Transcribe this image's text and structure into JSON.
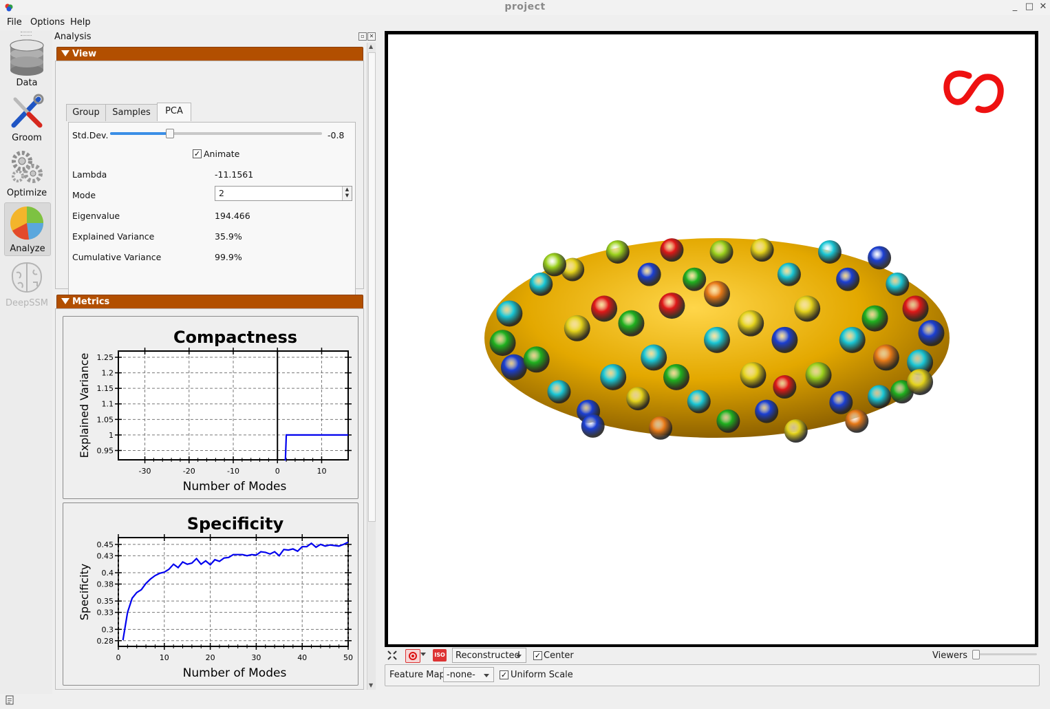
{
  "window": {
    "title": "project"
  },
  "menu": [
    "File",
    "Options",
    "Help"
  ],
  "toolbar": {
    "items": [
      {
        "label": "Data",
        "icon": "database-icon"
      },
      {
        "label": "Groom",
        "icon": "groom-tools-icon"
      },
      {
        "label": "Optimize",
        "icon": "gears-icon"
      },
      {
        "label": "Analyze",
        "icon": "pie-chart-icon"
      },
      {
        "label": "DeepSSM",
        "icon": "brain-icon"
      }
    ],
    "active": "Analyze"
  },
  "analysis": {
    "title": "Analysis",
    "view_section": "View",
    "tabs": [
      "Group",
      "Samples",
      "PCA"
    ],
    "active_tab": "PCA",
    "std_dev": {
      "label": "Std.Dev.",
      "value": "-0.8",
      "position_fraction": 0.28
    },
    "animate": {
      "label": "Animate",
      "checked": true
    },
    "rows": [
      {
        "label": "Lambda",
        "value": "-11.1561"
      },
      {
        "label": "Mode",
        "value": "2"
      },
      {
        "label": "Eigenvalue",
        "value": "194.466"
      },
      {
        "label": "Explained Variance",
        "value": "35.9%"
      },
      {
        "label": "Cumulative Variance",
        "value": "99.9%"
      }
    ],
    "metrics_section": "Metrics"
  },
  "chart_data": [
    {
      "type": "line",
      "title": "Compactness",
      "xlabel": "Number of Modes",
      "ylabel": "Explained Variance",
      "xlim": [
        -36,
        16
      ],
      "ylim": [
        0.92,
        1.27
      ],
      "xticks": [
        -30,
        -20,
        -10,
        0,
        10
      ],
      "yticks": [
        0.95,
        1,
        1.05,
        1.1,
        1.15,
        1.2,
        1.25
      ],
      "ytick_labels": [
        "0.95",
        "1",
        "1.05",
        "1.1",
        "1.15",
        "1.2",
        "1.25"
      ],
      "grid": true,
      "series": [
        {
          "color": "#0000ee",
          "x": [
            1.6,
            1.8,
            2,
            3,
            5,
            8,
            11,
            14,
            16
          ],
          "y": [
            0.92,
            0.92,
            1.0,
            1.0,
            1.0,
            1.0,
            1.0,
            1.0,
            1.0
          ]
        }
      ]
    },
    {
      "type": "line",
      "title": "Specificity",
      "xlabel": "Number of Modes",
      "ylabel": "Specificity",
      "xlim": [
        0,
        50
      ],
      "ylim": [
        0.27,
        0.462
      ],
      "xticks": [
        0,
        10,
        20,
        30,
        40,
        50
      ],
      "yticks": [
        0.28,
        0.3,
        0.33,
        0.35,
        0.38,
        0.4,
        0.43,
        0.45
      ],
      "ytick_labels": [
        "0.28",
        "0.3",
        "0.33",
        "0.35",
        "0.38",
        "0.4",
        "0.43",
        "0.45"
      ],
      "grid": true,
      "series": [
        {
          "color": "#0000ee",
          "x": [
            1,
            2,
            3,
            4,
            5,
            6,
            7,
            8,
            9,
            10,
            11,
            12,
            13,
            14,
            15,
            16,
            17,
            18,
            19,
            20,
            21,
            22,
            23,
            24,
            25,
            26,
            27,
            28,
            29,
            30,
            31,
            32,
            33,
            34,
            35,
            36,
            37,
            38,
            39,
            40,
            41,
            42,
            43,
            44,
            45,
            46,
            47,
            48,
            49,
            50
          ],
          "y": [
            0.281,
            0.33,
            0.355,
            0.365,
            0.37,
            0.381,
            0.389,
            0.395,
            0.399,
            0.401,
            0.406,
            0.415,
            0.409,
            0.419,
            0.415,
            0.417,
            0.425,
            0.415,
            0.421,
            0.414,
            0.423,
            0.42,
            0.426,
            0.427,
            0.432,
            0.432,
            0.432,
            0.43,
            0.432,
            0.431,
            0.437,
            0.436,
            0.433,
            0.437,
            0.43,
            0.441,
            0.44,
            0.442,
            0.438,
            0.446,
            0.446,
            0.452,
            0.445,
            0.45,
            0.447,
            0.449,
            0.448,
            0.447,
            0.45,
            0.454
          ]
        }
      ]
    }
  ],
  "viewer_toolbar": {
    "display_mode": "Reconstructed",
    "center": {
      "label": "Center",
      "checked": true
    },
    "viewers_label": "Viewers"
  },
  "feature_bar": {
    "feature_map_label": "Feature Map",
    "feature_map_value": "-none-",
    "uniform_scale": {
      "label": "Uniform Scale",
      "checked": true
    }
  },
  "colors": {
    "section_header": "#b24f00",
    "ellipsoid": "#e8b000",
    "logo_red": "#ee1111",
    "particle_palette": [
      "#e01818",
      "#1fb11f",
      "#19c7d6",
      "#1b3fd3",
      "#e3d21b",
      "#9bd11d",
      "#e87a18"
    ]
  }
}
